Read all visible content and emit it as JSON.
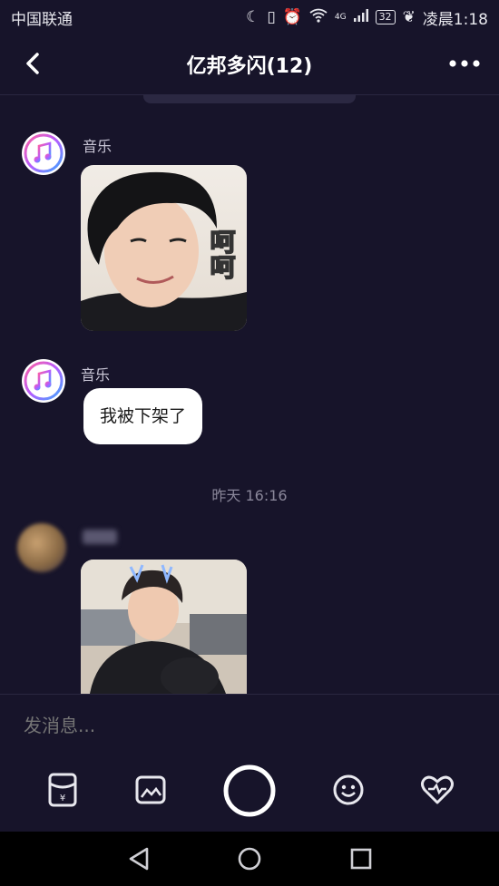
{
  "status": {
    "carrier": "中国联通",
    "network": "4G",
    "battery": "32",
    "time": "凌晨1:18"
  },
  "header": {
    "title": "亿邦多闪(12)"
  },
  "messages": [
    {
      "sender": "音乐",
      "type": "image",
      "sticker_text": "呵呵"
    },
    {
      "sender": "音乐",
      "type": "text",
      "text": "我被下架了"
    }
  ],
  "timestamp": "昨天 16:16",
  "input": {
    "placeholder": "发消息..."
  },
  "toolbar": {
    "items": [
      "red-packet-icon",
      "image-icon",
      "camera-shutter-icon",
      "emoji-icon",
      "heart-icon"
    ]
  },
  "colors": {
    "background": "#17142a",
    "bubble": "#ffffff",
    "accent": "#ffffff"
  }
}
